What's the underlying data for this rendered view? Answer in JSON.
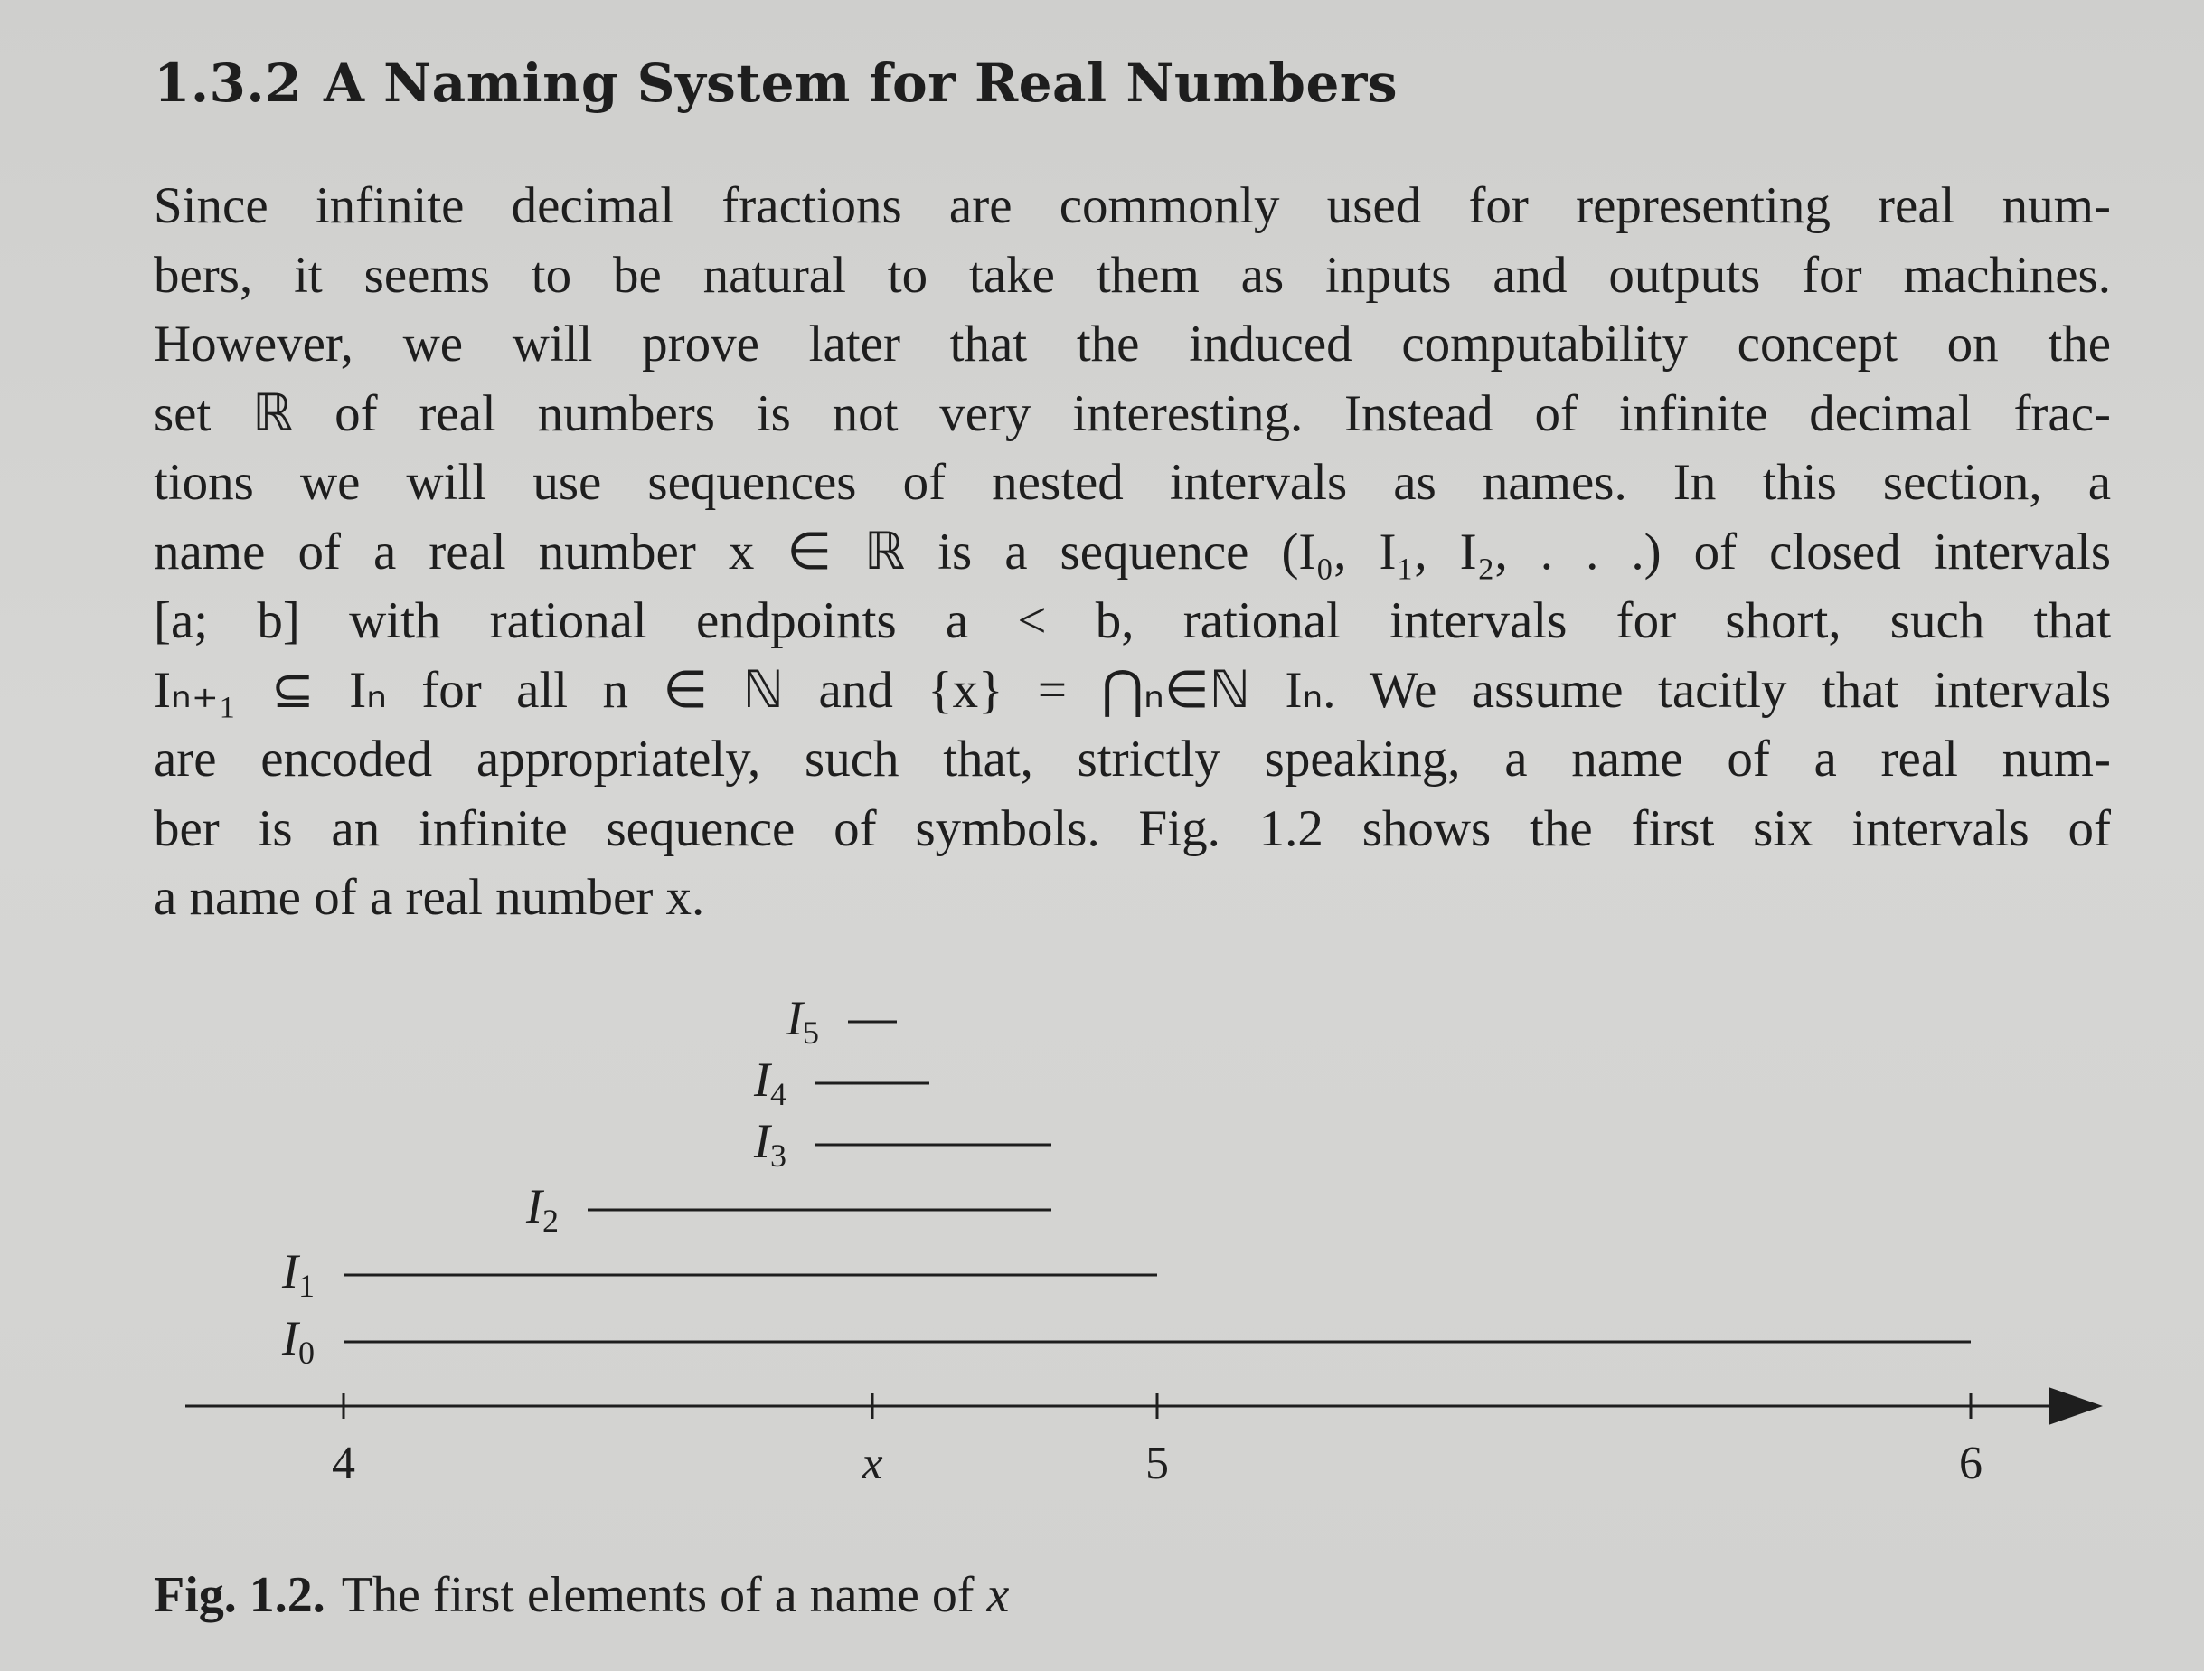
{
  "section": {
    "number": "1.3.2",
    "title": "A Naming System for Real Numbers"
  },
  "paragraph": {
    "lines": [
      "Since infinite decimal fractions are commonly used for representing real num-",
      "bers, it seems to be natural to take them as inputs and outputs for machines.",
      "However, we will prove later that the induced computability concept on the",
      "set ℝ of real numbers is not very interesting. Instead of infinite decimal frac-",
      "tions we will use sequences of nested intervals as names. In this section, a",
      "name of a real number x ∈ ℝ is a sequence (I₀, I₁, I₂, . . .) of closed intervals",
      "[a; b] with rational endpoints a < b, rational intervals for short, such that",
      "Iₙ₊₁ ⊆ Iₙ for all n ∈ ℕ and {x} = ⋂ₙ∈ℕ Iₙ. We assume tacitly that intervals",
      "are encoded appropriately, such that, strictly speaking, a name of a real num-",
      "ber is an infinite sequence of symbols. Fig. 1.2 shows the first six intervals of",
      "a name of a real number x."
    ]
  },
  "figure": {
    "axis_ticks": [
      {
        "label": "4",
        "value": 4
      },
      {
        "label": "x",
        "value": 4.65
      },
      {
        "label": "5",
        "value": 5
      },
      {
        "label": "6",
        "value": 6
      }
    ],
    "intervals": [
      {
        "label": "I0",
        "name": "I",
        "sub": "0",
        "from": 4.0,
        "to": 6.0
      },
      {
        "label": "I1",
        "name": "I",
        "sub": "1",
        "from": 4.0,
        "to": 5.0
      },
      {
        "label": "I2",
        "name": "I",
        "sub": "2",
        "from": 4.3,
        "to": 4.87
      },
      {
        "label": "I3",
        "name": "I",
        "sub": "3",
        "from": 4.58,
        "to": 4.87
      },
      {
        "label": "I4",
        "name": "I",
        "sub": "4",
        "from": 4.58,
        "to": 4.72
      },
      {
        "label": "I5",
        "name": "I",
        "sub": "5",
        "from": 4.62,
        "to": 4.68
      }
    ]
  },
  "caption": {
    "label": "Fig. 1.2.",
    "text": "The first elements of a name of ",
    "var": "x"
  }
}
